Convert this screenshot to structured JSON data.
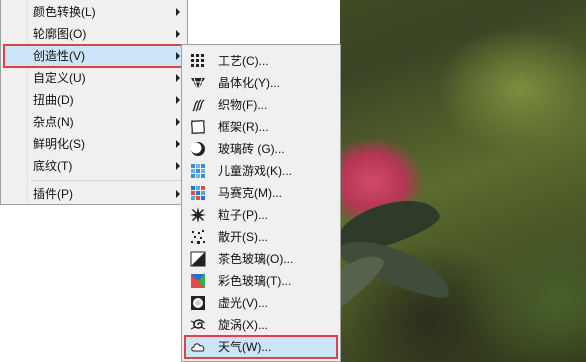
{
  "main_menu": {
    "items": [
      {
        "label": "颜色转换(L)",
        "has_submenu": true
      },
      {
        "label": "轮廓图(O)",
        "has_submenu": true
      },
      {
        "label": "创造性(V)",
        "has_submenu": true,
        "active": true
      },
      {
        "label": "自定义(U)",
        "has_submenu": true
      },
      {
        "label": "扭曲(D)",
        "has_submenu": true
      },
      {
        "label": "杂点(N)",
        "has_submenu": true
      },
      {
        "label": "鲜明化(S)",
        "has_submenu": true
      },
      {
        "label": "底纹(T)",
        "has_submenu": true
      },
      {
        "label": "插件(P)",
        "has_submenu": true
      }
    ]
  },
  "creative_submenu": {
    "items": [
      {
        "label": "工艺(C)...",
        "icon": "craft-icon"
      },
      {
        "label": "晶体化(Y)...",
        "icon": "crystallize-icon"
      },
      {
        "label": "织物(F)...",
        "icon": "fabric-icon"
      },
      {
        "label": "框架(R)...",
        "icon": "frame-icon"
      },
      {
        "label": "玻璃砖 (G)...",
        "icon": "glass-block-icon"
      },
      {
        "label": "儿童游戏(K)...",
        "icon": "kids-play-icon"
      },
      {
        "label": "马赛克(M)...",
        "icon": "mosaic-icon"
      },
      {
        "label": "粒子(P)...",
        "icon": "particles-icon"
      },
      {
        "label": "散开(S)...",
        "icon": "scatter-icon"
      },
      {
        "label": "茶色玻璃(O)...",
        "icon": "smoked-glass-icon"
      },
      {
        "label": "彩色玻璃(T)...",
        "icon": "stained-glass-icon"
      },
      {
        "label": "虚光(V)...",
        "icon": "vignette-icon"
      },
      {
        "label": "旋涡(X)...",
        "icon": "vortex-icon"
      },
      {
        "label": "天气(W)...",
        "icon": "weather-icon",
        "active": true
      }
    ]
  },
  "colors": {
    "highlight": "#cce4f7",
    "highlight_border": "#e0424a",
    "menu_bg": "#f0f0f0"
  }
}
